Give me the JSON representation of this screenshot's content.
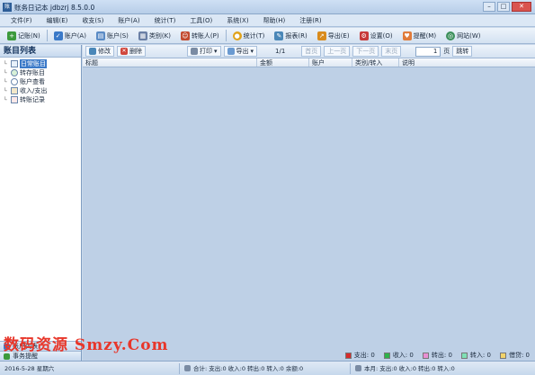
{
  "window": {
    "title": "账务日记本 jdbzrj 8.5.0.0"
  },
  "menu": [
    "文件(F)",
    "编辑(E)",
    "收支(S)",
    "账户(A)",
    "统计(T)",
    "工具(O)",
    "系统(X)",
    "帮助(H)",
    "注册(R)"
  ],
  "toolbar": [
    {
      "label": "记账(N)",
      "icon": "add-entry-icon",
      "color": "#3c9a3c"
    },
    {
      "label": "账户(A)",
      "icon": "account-icon",
      "color": "#3a79c8"
    },
    {
      "label": "账户(S)",
      "icon": "accounts-icon",
      "color": "#5a8bc5"
    },
    {
      "label": "类别(K)",
      "icon": "category-icon",
      "color": "#6a7fa5"
    },
    {
      "label": "转账人(P)",
      "icon": "person-icon",
      "color": "#c24b2f"
    },
    {
      "label": "统计(T)",
      "icon": "stats-icon",
      "color": "#e0a21a"
    },
    {
      "label": "报表(R)",
      "icon": "report-icon",
      "color": "#4a87b8"
    },
    {
      "label": "导出(E)",
      "icon": "export-icon",
      "color": "#d98b1c"
    },
    {
      "label": "设置(O)",
      "icon": "settings-icon",
      "color": "#c73a3a"
    },
    {
      "label": "提醒(M)",
      "icon": "reminder-icon",
      "color": "#e07b3a"
    },
    {
      "label": "网站(W)",
      "icon": "web-icon",
      "color": "#3b8f5a"
    }
  ],
  "sidebar": {
    "title": "账目列表",
    "items": [
      {
        "label": "日常账目",
        "selected": true
      },
      {
        "label": "转存账目",
        "selected": false
      },
      {
        "label": "账户查看",
        "selected": false
      },
      {
        "label": "收入/支出",
        "selected": false
      },
      {
        "label": "转账记录",
        "selected": false
      }
    ],
    "bottom_tabs": [
      "账户列表",
      "事务提醒"
    ]
  },
  "main_toolbar": {
    "edit": "修改",
    "delete": "删除",
    "print": "打印",
    "export": "导出",
    "page_text": "1/1",
    "first": "首页",
    "prev": "上一页",
    "next": "下一页",
    "last": "末页",
    "page_value": "1",
    "page_suffix": "页",
    "go": "跳转"
  },
  "grid": {
    "columns": [
      "标题",
      "金额",
      "账户",
      "类别/转入",
      "说明"
    ]
  },
  "legend": [
    {
      "label": "支出: 0",
      "color": "#d62b2b"
    },
    {
      "label": "收入: 0",
      "color": "#2eb34a"
    },
    {
      "label": "转出: 0",
      "color": "#e98fd3"
    },
    {
      "label": "转入: 0",
      "color": "#7fe0b5"
    },
    {
      "label": "借贷: 0",
      "color": "#f2d36b"
    }
  ],
  "status": {
    "date": "2016-5-28 星期六",
    "summary": "合计: 支出:0 收入:0 转出:0 转入:0 余额:0",
    "month": "本月: 支出:0 收入:0 转出:0 转入:0"
  },
  "watermark": "数码资源 Smzy.Com"
}
